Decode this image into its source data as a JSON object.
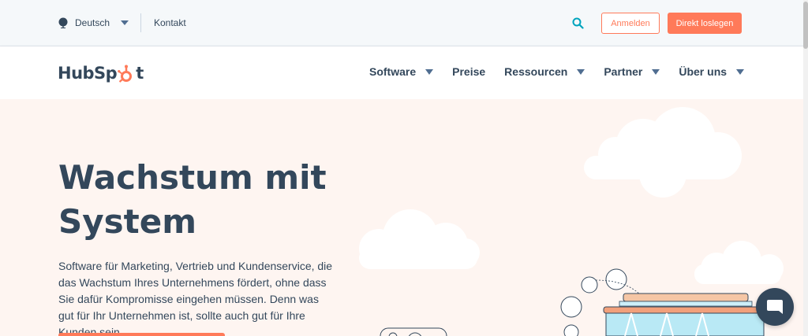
{
  "utility": {
    "language": "Deutsch",
    "contact": "Kontakt",
    "login_label": "Anmelden",
    "start_label": "Direkt loslegen"
  },
  "nav": {
    "logo_left": "HubSp",
    "logo_right": "t",
    "items": [
      {
        "label": "Software"
      },
      {
        "label": "Preise"
      },
      {
        "label": "Ressourcen"
      },
      {
        "label": "Partner"
      },
      {
        "label": "Über uns"
      }
    ]
  },
  "hero": {
    "title_line1": "Wachstum mit",
    "title_line2": "System",
    "subtitle": "Software für Marketing, Vertrieb und Kundenservice, die das Wachstum Ihres Unternehmens fördert, ohne dass Sie dafür Kompromisse eingehen müssen. Denn was gut für Ihr Unternehmen ist, sollte auch gut für Ihre Kunden sein."
  },
  "icons": {
    "globe": "globe-icon",
    "search": "search-icon",
    "chat": "chat-icon",
    "sprocket": "sprocket-icon"
  },
  "colors": {
    "brand_orange": "#ff7a59",
    "text_dark": "#33475b",
    "search_teal": "#00a4bd",
    "hero_bg": "#fef5f1",
    "utility_bg": "#f5f8fa"
  }
}
